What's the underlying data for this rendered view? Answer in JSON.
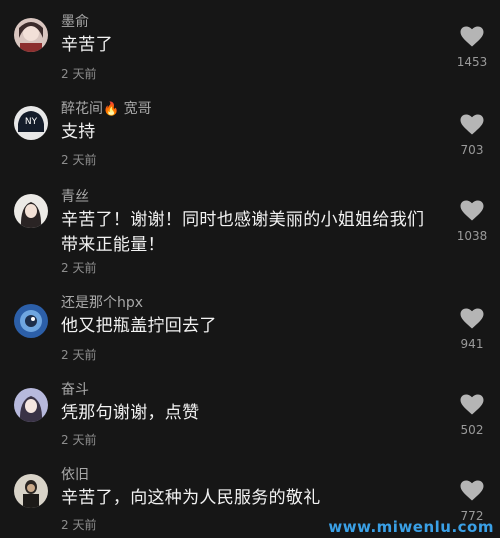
{
  "comments": [
    {
      "username": "墨俞",
      "text": "辛苦了",
      "time": "2 天前",
      "likes": "1453"
    },
    {
      "username": "醉花间",
      "flame": "🔥",
      "username_suffix": "宽哥",
      "text": "支持",
      "time": "2 天前",
      "likes": "703"
    },
    {
      "username": "青丝",
      "text": "辛苦了！谢谢！同时也感谢美丽的小姐姐给我们带来正能量！",
      "time": "2 天前",
      "likes": "1038"
    },
    {
      "username": "还是那个hpx",
      "text": "他又把瓶盖拧回去了",
      "time": "2 天前",
      "likes": "941"
    },
    {
      "username": "奋斗",
      "text": "凭那句谢谢，点赞",
      "time": "2 天前",
      "likes": "502"
    },
    {
      "username": "依旧",
      "text": "辛苦了，向这种为人民服务的敬礼",
      "time": "2 天前",
      "likes": "772"
    }
  ],
  "icons": {
    "like": "heart-icon"
  },
  "colors": {
    "background": "#161616",
    "username": "#a8a8a8",
    "text": "#f2f2f2",
    "watermark": "#3aa0e6"
  },
  "watermark": "www.miwenlu.com"
}
